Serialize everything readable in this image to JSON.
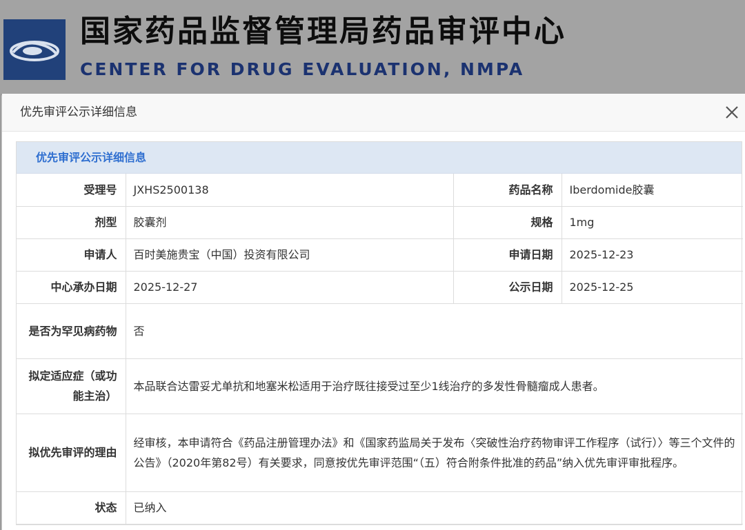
{
  "site": {
    "title_cn": "国家药品监督管理局药品审评中心",
    "title_en": "CENTER FOR DRUG EVALUATION, NMPA",
    "logo_icon": "cde-logo-icon"
  },
  "modal": {
    "title": "优先审评公示详细信息",
    "close_icon": "close-icon"
  },
  "panel": {
    "heading": "优先审评公示详细信息",
    "accent_color": "#2f6fd0",
    "fields": {
      "acceptance_no_label": "受理号",
      "acceptance_no": "JXHS2500138",
      "drug_name_label": "药品名称",
      "drug_name": "Iberdomide胶囊",
      "dosage_form_label": "剂型",
      "dosage_form": "胶囊剂",
      "spec_label": "规格",
      "spec": "1mg",
      "applicant_label": "申请人",
      "applicant": "百时美施贵宝（中国）投资有限公司",
      "apply_date_label": "申请日期",
      "apply_date": "2025-12-23",
      "center_date_label": "中心承办日期",
      "center_date": "2025-12-27",
      "publish_date_label": "公示日期",
      "publish_date": "2025-12-25",
      "rare_disease_label": "是否为罕见病药物",
      "rare_disease": "否",
      "indication_label": "拟定适应症（或功能主治）",
      "indication": "本品联合达雷妥尤单抗和地塞米松适用于治疗既往接受过至少1线治疗的多发性骨髓瘤成人患者。",
      "reason_label": "拟优先审评的理由",
      "reason": "经审核，本申请符合《药品注册管理办法》和《国家药监局关于发布〈突破性治疗药物审评工作程序（试行）〉等三个文件的公告》（2020年第82号）有关要求，同意按优先审评范围“（五）符合附条件批准的药品”纳入优先审评审批程序。",
      "status_label": "状态",
      "status": "已纳入"
    }
  }
}
